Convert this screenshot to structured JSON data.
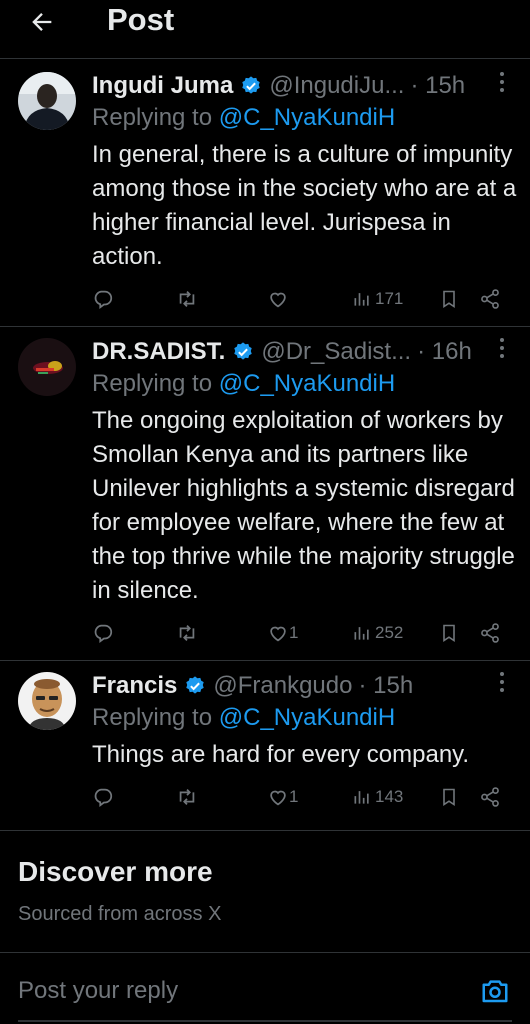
{
  "header": {
    "title": "Post"
  },
  "colors": {
    "accent": "#1d9bf0",
    "muted": "#71767b",
    "text": "#e7e9ea",
    "background": "#000000",
    "divider": "#2f3336"
  },
  "tweets": [
    {
      "name": "Ingudi Juma",
      "handle": "@IngudiJu...",
      "time": "· 15h",
      "replying_label": "Replying to",
      "replying_to": "@C_NyaKundiH",
      "text": "In general, there is a culture of impunity among those in the society who are at a higher financial level. Jurispesa in action.",
      "likes": "",
      "views": "171",
      "verified": true
    },
    {
      "name": "DR.SADIST.",
      "handle": "@Dr_Sadist...",
      "time": "· 16h",
      "replying_label": "Replying to",
      "replying_to": "@C_NyaKundiH",
      "text": "The ongoing exploitation of workers by Smollan Kenya and its partners like Unilever highlights a systemic disregard for employee welfare, where the few at the top thrive while the majority struggle in silence.",
      "likes": "1",
      "views": "252",
      "verified": true
    },
    {
      "name": "Francis",
      "handle": "@Frankgudo",
      "time": "· 15h",
      "replying_label": "Replying to",
      "replying_to": "@C_NyaKundiH",
      "text": "Things are hard for every company.",
      "likes": "1",
      "views": "143",
      "verified": true
    }
  ],
  "discover": {
    "title": "Discover more",
    "subtitle": "Sourced from across X"
  },
  "reply": {
    "placeholder": "Post your reply"
  },
  "icons": [
    "back-arrow-icon",
    "verified-badge-icon",
    "more-icon",
    "reply-icon",
    "retweet-icon",
    "like-icon",
    "views-icon",
    "bookmark-icon",
    "share-icon",
    "camera-icon"
  ]
}
